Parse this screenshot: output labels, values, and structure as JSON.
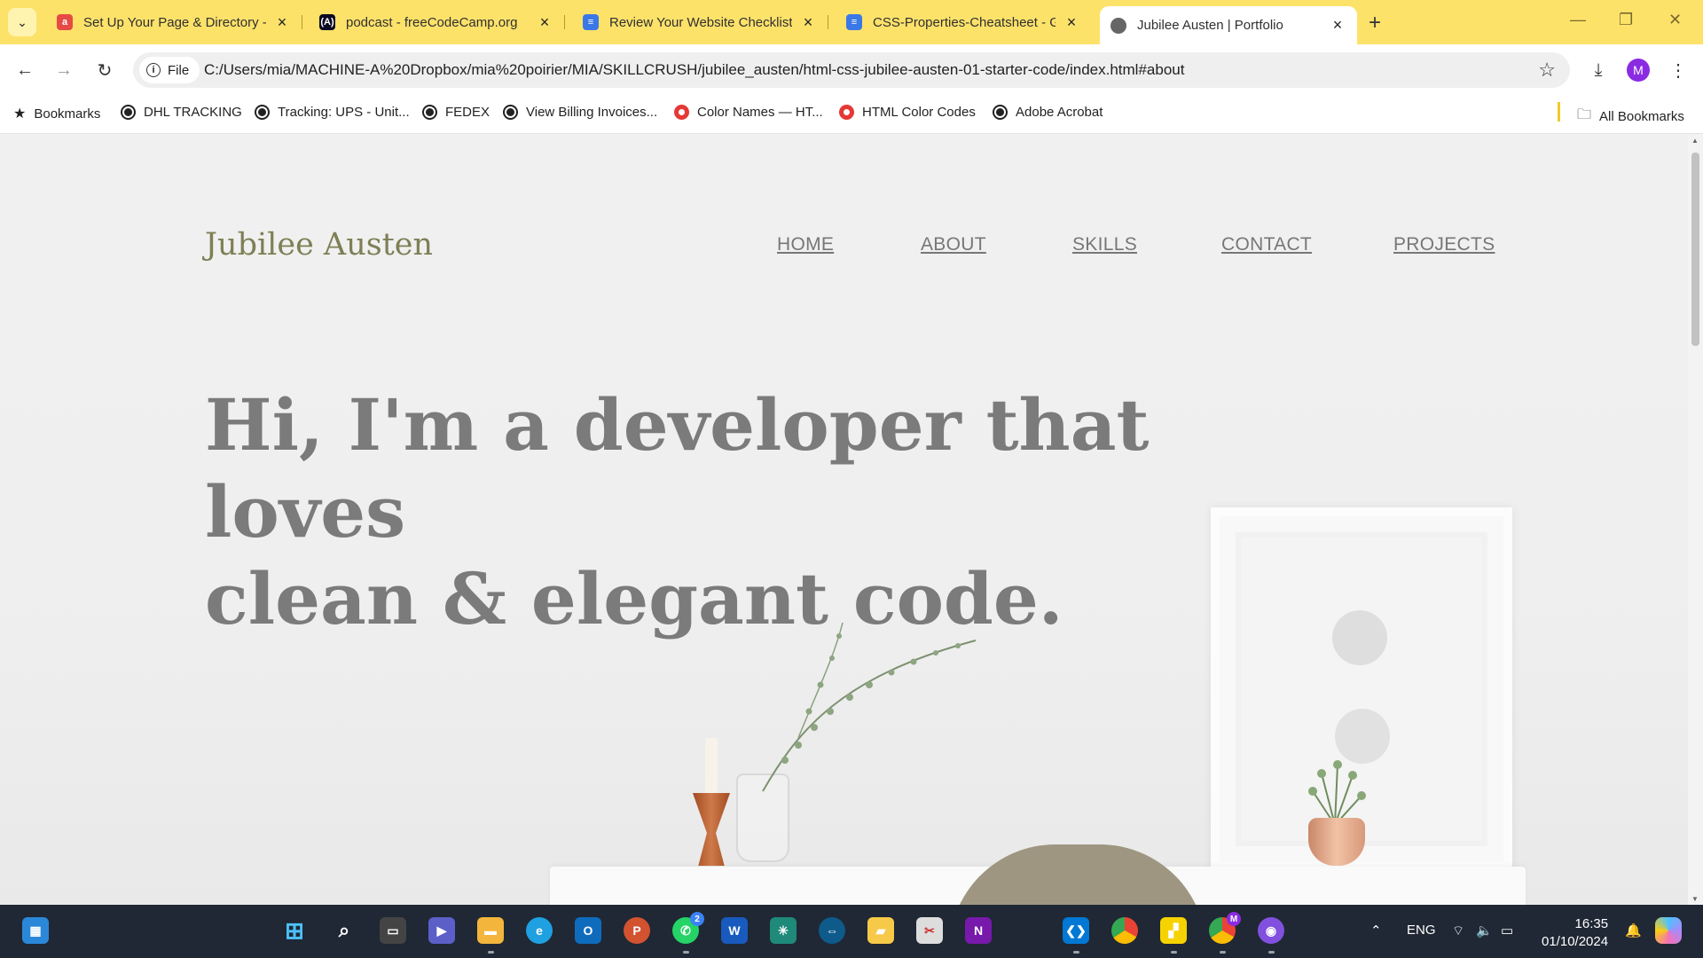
{
  "browser": {
    "tabs": [
      {
        "title": "Set Up Your Page & Directory -",
        "favicon_color": "#e64a45"
      },
      {
        "title": "podcast - freeCodeCamp.org",
        "favicon_color": "#0a0a23"
      },
      {
        "title": "Review Your Website Checklist",
        "favicon_color": "#3b78e7"
      },
      {
        "title": "CSS-Properties-Cheatsheet - Go",
        "favicon_color": "#3b78e7"
      },
      {
        "title": "Jubilee Austen | Portfolio",
        "favicon_color": "#555555",
        "active": true
      }
    ],
    "new_tab_label": "+",
    "window_controls": {
      "minimize": "—",
      "restore": "❐",
      "close": "✕"
    },
    "address": {
      "scheme_label": "File",
      "url": "C:/Users/mia/MACHINE-A%20Dropbox/mia%20poirier/MIA/SKILLCRUSH/jubilee_austen/html-css-jubilee-austen-01-starter-code/index.html#about"
    },
    "profile_initial": "M",
    "bookmarks": [
      {
        "label": "Bookmarks",
        "icon": "star-icon"
      },
      {
        "label": "DHL TRACKING",
        "icon": "globe-icon"
      },
      {
        "label": "Tracking: UPS - Unit...",
        "icon": "globe-icon"
      },
      {
        "label": "FEDEX",
        "icon": "globe-icon"
      },
      {
        "label": "View Billing Invoices...",
        "icon": "globe-icon"
      },
      {
        "label": "Color Names — HT...",
        "icon": "red-circle-icon"
      },
      {
        "label": "HTML Color Codes",
        "icon": "red-circle-icon"
      },
      {
        "label": "Adobe Acrobat",
        "icon": "globe-icon"
      }
    ],
    "all_bookmarks_label": "All Bookmarks"
  },
  "page": {
    "logo": "Jubilee Austen",
    "nav": [
      "HOME",
      "ABOUT",
      "SKILLS",
      "CONTACT",
      "PROJECTS"
    ],
    "hero_line1": "Hi, I'm a developer that loves",
    "hero_line2": "clean & elegant code."
  },
  "taskbar": {
    "whatsapp_badge": "2",
    "chrome_profile_badge": "M",
    "language": "ENG",
    "time": "16:35",
    "date": "01/10/2024"
  },
  "colors": {
    "tabstrip": "#fde26a",
    "logo": "#7e7f55",
    "hero_text": "#7b7b7b",
    "nav_text": "#777777",
    "taskbar": "#1f2834"
  }
}
